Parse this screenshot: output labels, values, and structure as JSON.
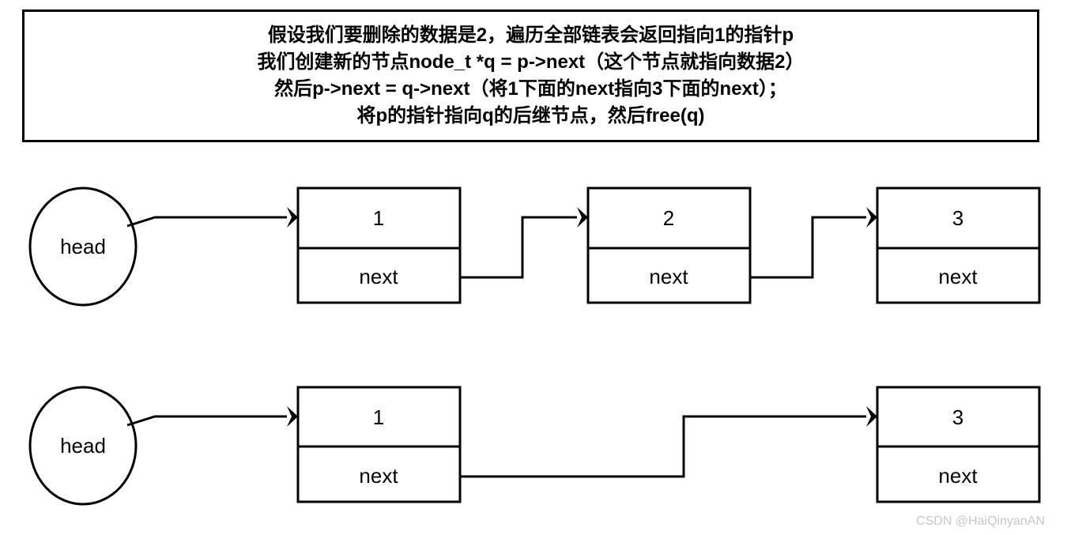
{
  "note": {
    "lines": [
      "假设我们要删除的数据是2，遍历全部链表会返回指向1的指针p",
      "我们创建新的节点node_t *q = p->next（这个节点就指向数据2）",
      "然后p->next = q->next（将1下面的next指向3下面的next）；",
      "将p的指针指向q的后继节点，然后free(q)"
    ]
  },
  "diagram": {
    "rows": [
      {
        "id": "before",
        "head_label": "head",
        "nodes": [
          {
            "value": "1",
            "pointer_label": "next"
          },
          {
            "value": "2",
            "pointer_label": "next"
          },
          {
            "value": "3",
            "pointer_label": "next"
          }
        ]
      },
      {
        "id": "after",
        "head_label": "head",
        "nodes": [
          {
            "value": "1",
            "pointer_label": "next"
          },
          {
            "value": "3",
            "pointer_label": "next"
          }
        ]
      }
    ]
  },
  "watermark": {
    "text": "CSDN @HaiQinyanAN"
  },
  "colors": {
    "stroke": "#000000",
    "background": "#ffffff",
    "watermark": "#c8c8c8"
  }
}
